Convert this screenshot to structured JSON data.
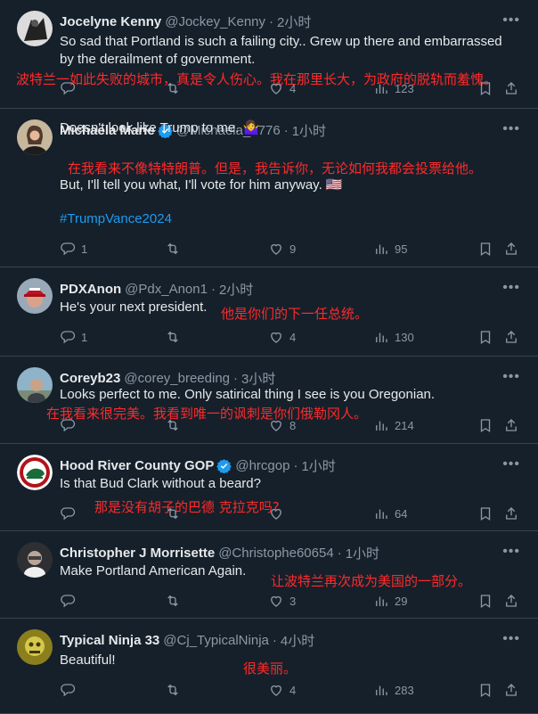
{
  "tweets": [
    {
      "name": "Jocelyne Kenny",
      "handle": "@Jockey_Kenny",
      "time": "2小时",
      "verified": false,
      "lines": [
        "So sad that Portland is such a failing city.. Grew up there and embarrassed",
        "by the derailment of government."
      ],
      "translation": "波特兰一如此失败的城市，真是令人伤心。我在那里长大，为政府的脱轨而羞愧。",
      "replies": "",
      "retweets": "",
      "likes": "4",
      "views": "123"
    },
    {
      "name": "Michaela Marie",
      "handle": "@Michaela_1776",
      "time": "1小时",
      "verified": true,
      "lines": [
        "Doesn't look like Trump to me. 🤷‍♀️",
        "But, I'll tell you what, I'll vote for him anyway. 🇺🇸"
      ],
      "hashtag": "#TrumpVance2024",
      "translation": "在我看来不像特特朗普。但是，我告诉你，无论如何我都会投票给他。",
      "replies": "1",
      "retweets": "",
      "likes": "9",
      "views": "95"
    },
    {
      "name": "PDXAnon",
      "handle": "@Pdx_Anon1",
      "time": "2小时",
      "verified": false,
      "lines": [
        "He's your next president."
      ],
      "translation": "他是你们的下一任总统。",
      "replies": "1",
      "retweets": "",
      "likes": "4",
      "views": "130"
    },
    {
      "name": "Coreyb23",
      "handle": "@corey_breeding",
      "time": "3小时",
      "verified": false,
      "lines": [
        "Looks perfect to me. Only satirical thing I see is you Oregonian."
      ],
      "translation": "在我看来很完美。我看到唯一的讽刺是你们俄勒冈人。",
      "replies": "",
      "retweets": "",
      "likes": "8",
      "views": "214"
    },
    {
      "name": "Hood River County GOP",
      "handle": "@hrcgop",
      "time": "1小时",
      "verified": true,
      "lines": [
        "Is that Bud Clark without a beard?"
      ],
      "translation": "那是没有胡子的巴德 克拉克吗?",
      "replies": "",
      "retweets": "",
      "likes": "",
      "views": "64"
    },
    {
      "name": "Christopher J Morrisette",
      "handle": "@Christophe60654",
      "time": "1小时",
      "verified": false,
      "lines": [
        "Make Portland American Again."
      ],
      "translation": "让波特兰再次成为美国的一部分。",
      "replies": "",
      "retweets": "",
      "likes": "3",
      "views": "29"
    },
    {
      "name": "Typical Ninja 33",
      "handle": "@Cj_TypicalNinja",
      "time": "4小时",
      "verified": false,
      "lines": [
        "Beautiful!"
      ],
      "translation": "很美丽。",
      "replies": "",
      "retweets": "",
      "likes": "4",
      "views": "283"
    }
  ],
  "separator": "·",
  "colors": {
    "background": "#15202b",
    "text": "#e7e9ea",
    "muted": "#8b98a5",
    "link": "#1d9bf0",
    "translation": "#ff2a2a",
    "verified": "#1d9bf0"
  },
  "icons": [
    "reply-icon",
    "retweet-icon",
    "like-icon",
    "views-icon",
    "bookmark-icon",
    "share-icon",
    "more-icon",
    "verified-icon"
  ]
}
